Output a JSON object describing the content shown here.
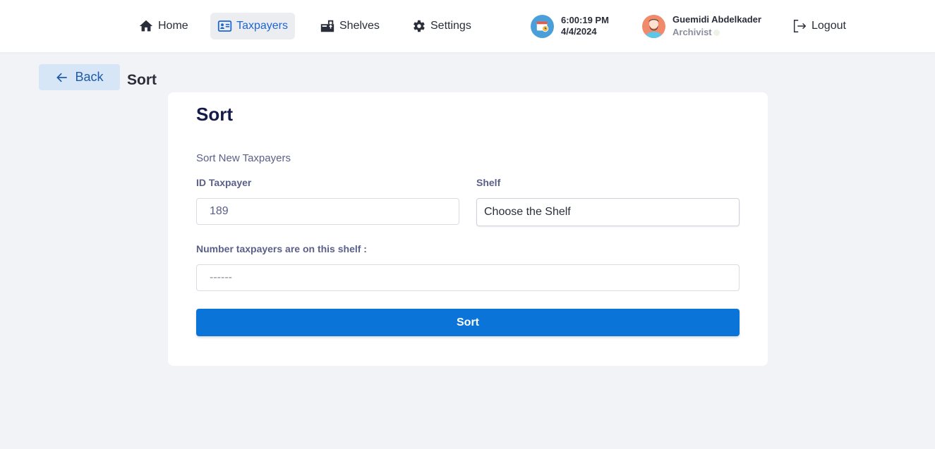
{
  "nav": {
    "items": [
      {
        "label": "Home",
        "icon": "home-icon"
      },
      {
        "label": "Taxpayers",
        "icon": "id-card-icon",
        "active": true
      },
      {
        "label": "Shelves",
        "icon": "shelves-icon"
      },
      {
        "label": "Settings",
        "icon": "gear-icon"
      }
    ],
    "accent_color": "#1b66d6"
  },
  "clock": {
    "time": "6:00:19 PM",
    "date": "4/4/2024"
  },
  "user": {
    "name": "Guemidi Abdelkader",
    "role": "Archivist"
  },
  "logout_label": "Logout",
  "back_label": "Back",
  "page_title": "Sort",
  "form": {
    "title": "Sort",
    "subtitle": "Sort New Taxpayers",
    "id_label": "ID Taxpayer",
    "id_value": "189",
    "shelf_label": "Shelf",
    "shelf_selected": "Choose the Shelf",
    "count_label": "Number taxpayers are on this shelf :",
    "count_placeholder": "------",
    "submit_label": "Sort",
    "submit_color": "#0b74d9"
  }
}
